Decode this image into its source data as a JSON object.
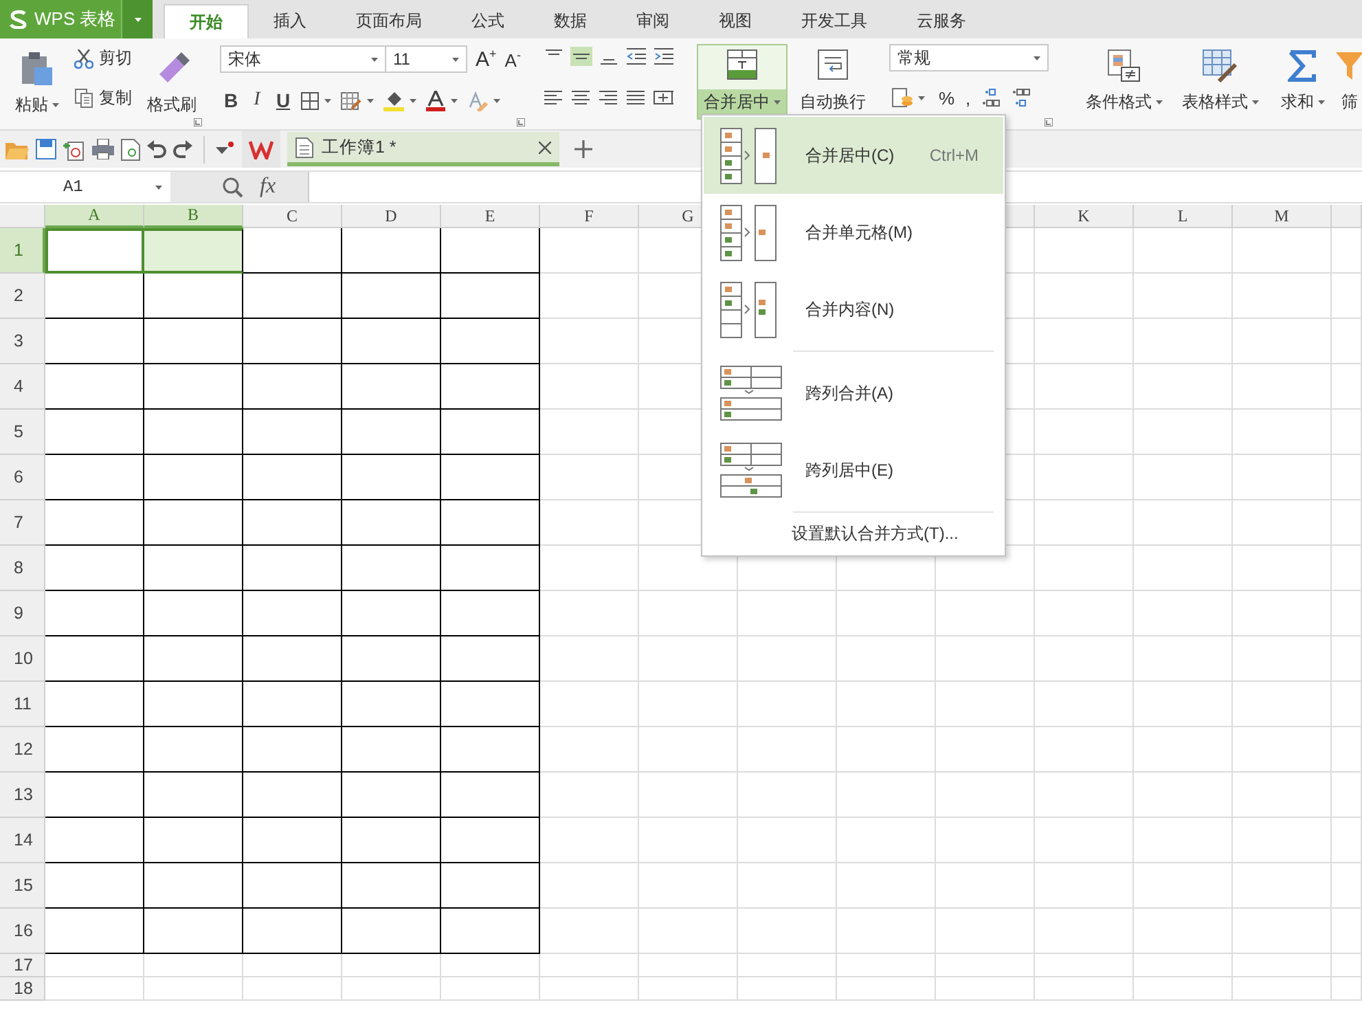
{
  "app": {
    "logo": "WPS 表格"
  },
  "tabs": [
    {
      "label": "开始",
      "selected": true
    },
    {
      "label": "插入",
      "selected": false
    },
    {
      "label": "页面布局",
      "selected": false
    },
    {
      "label": "公式",
      "selected": false
    },
    {
      "label": "数据",
      "selected": false
    },
    {
      "label": "审阅",
      "selected": false
    },
    {
      "label": "视图",
      "selected": false
    },
    {
      "label": "开发工具",
      "selected": false
    },
    {
      "label": "云服务",
      "selected": false
    }
  ],
  "ribbon": {
    "paste": "粘贴",
    "cut": "剪切",
    "copy": "复制",
    "format_painter": "格式刷",
    "font_name": "宋体",
    "font_size": "11",
    "font_grow": "A$^{+}$",
    "font_shrink": "A$^{-}$",
    "bold": "B",
    "italic": "I",
    "underline": "U",
    "merge_center": {
      "label": "合并居中",
      "selected": true
    },
    "wrap_text": "自动换行",
    "number_format": "常规",
    "percent": "%",
    "thousands": ",",
    "conditional_format": "条件格式",
    "table_style": "表格样式",
    "sum": "求和",
    "filter": "筛"
  },
  "quick_bar": {
    "document_tab": {
      "title": "工作簿1 *",
      "selected": true
    }
  },
  "formula_bar": {
    "name_box": "A1",
    "function_label": "fx"
  },
  "sheet": {
    "columns": [
      {
        "label": "A",
        "selected": true,
        "bordered": true
      },
      {
        "label": "B",
        "selected": true,
        "bordered": true
      },
      {
        "label": "C",
        "selected": false,
        "bordered": true
      },
      {
        "label": "D",
        "selected": false,
        "bordered": true
      },
      {
        "label": "E",
        "selected": false,
        "bordered": true
      },
      {
        "label": "F",
        "selected": false,
        "bordered": false
      },
      {
        "label": "G",
        "selected": false,
        "bordered": false
      },
      {
        "bordered": false
      },
      {
        "bordered": false
      },
      {
        "bordered": false
      },
      {
        "label": "K",
        "selected": false,
        "bordered": false
      },
      {
        "label": "L",
        "selected": false,
        "bordered": false
      },
      {
        "label": "M",
        "selected": false,
        "bordered": false
      }
    ],
    "rows": [
      {
        "label": "1",
        "selected": true,
        "bordered": true
      },
      {
        "label": "2",
        "selected": false,
        "bordered": true
      },
      {
        "label": "3",
        "selected": false,
        "bordered": true
      },
      {
        "label": "4",
        "selected": false,
        "bordered": true
      },
      {
        "label": "5",
        "selected": false,
        "bordered": true
      },
      {
        "label": "6",
        "selected": false,
        "bordered": true
      },
      {
        "label": "7",
        "selected": false,
        "bordered": true
      },
      {
        "label": "8",
        "selected": false,
        "bordered": true
      },
      {
        "label": "9",
        "selected": false,
        "bordered": true
      },
      {
        "label": "10",
        "selected": false,
        "bordered": true
      },
      {
        "label": "11",
        "selected": false,
        "bordered": true
      },
      {
        "label": "12",
        "selected": false,
        "bordered": true
      },
      {
        "label": "13",
        "selected": false,
        "bordered": true
      },
      {
        "label": "14",
        "selected": false,
        "bordered": true
      },
      {
        "label": "15",
        "selected": false,
        "bordered": true
      },
      {
        "label": "16",
        "selected": false,
        "bordered": true
      },
      {
        "label": "17",
        "selected": false,
        "bordered": false
      },
      {
        "label": "18",
        "selected": false,
        "bordered": false
      }
    ]
  },
  "merge_menu": {
    "items": [
      {
        "kind": "center",
        "label": "合并居中(C)",
        "shortcut": "Ctrl+M",
        "selected": true
      },
      {
        "kind": "merge",
        "label": "合并单元格(M)",
        "selected": false
      },
      {
        "kind": "content",
        "label": "合并内容(N)",
        "selected": false
      },
      {
        "kind": "across",
        "label": "跨列合并(A)",
        "selected": false
      },
      {
        "kind": "across_center",
        "label": "跨列居中(E)",
        "selected": false
      }
    ],
    "footer": "设置默认合并方式(T)..."
  }
}
